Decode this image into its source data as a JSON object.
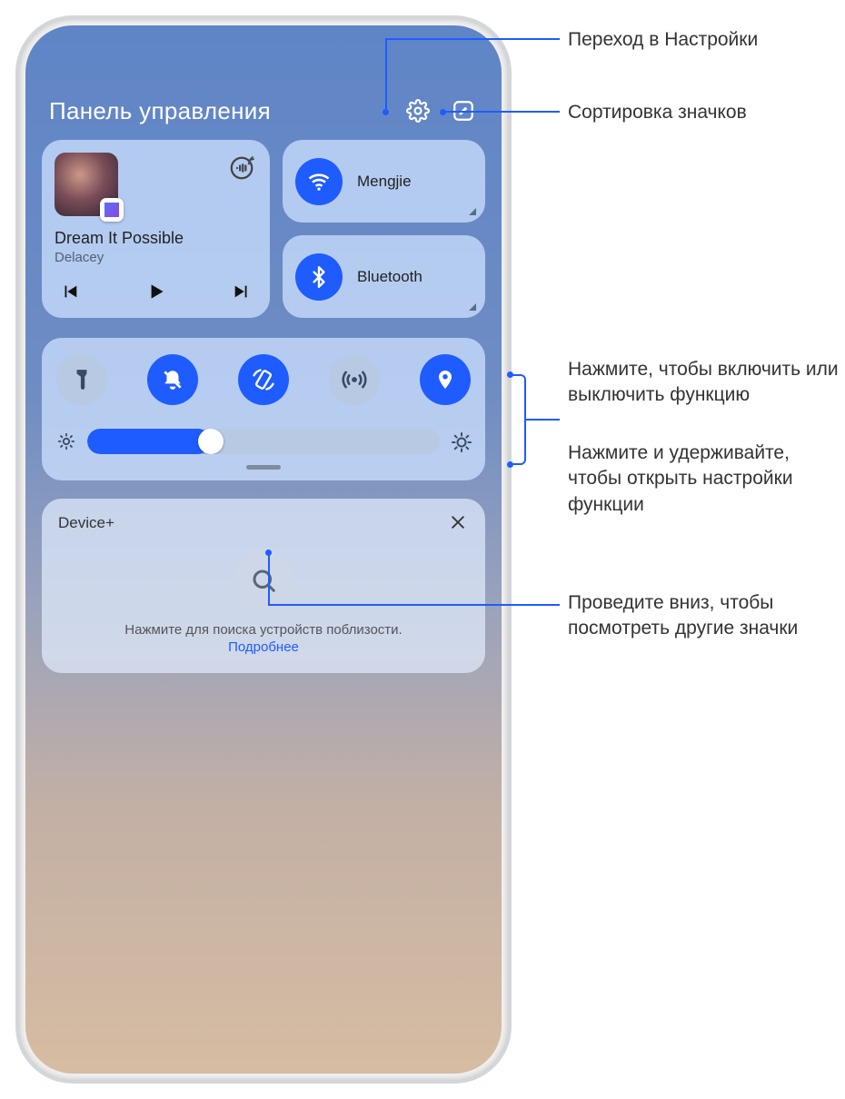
{
  "header": {
    "title": "Панель управления"
  },
  "music": {
    "title": "Dream It Possible",
    "artist": "Delacey"
  },
  "toggles": {
    "wifi_label": "Mengjie",
    "bt_label": "Bluetooth"
  },
  "device": {
    "title": "Device+",
    "hint": "Нажмите для поиска устройств поблизости.",
    "link": "Подробнее"
  },
  "annotations": {
    "settings": "Переход в Настройки",
    "sort": "Сортировка значков",
    "tap": "Нажмите, чтобы включить или выключить функцию",
    "hold": "Нажмите и удерживайте, чтобы открыть настройки функции",
    "swipe": "Проведите вниз, чтобы посмотреть другие значки"
  }
}
